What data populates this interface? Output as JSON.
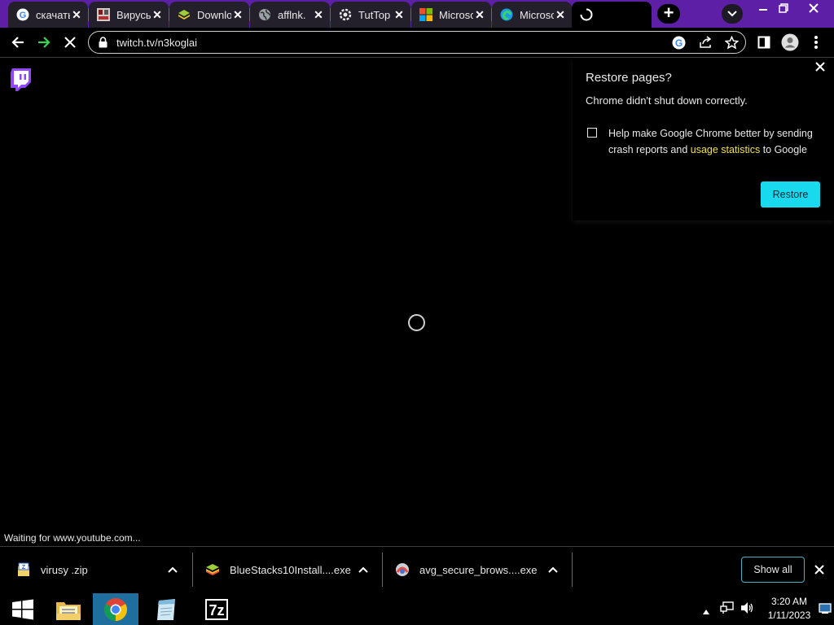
{
  "tabs": [
    {
      "title": "скачать",
      "icon": "google-icon"
    },
    {
      "title": "Вирусы",
      "icon": "site-thumbnail-icon"
    },
    {
      "title": "Download",
      "icon": "stack-icon"
    },
    {
      "title": "afflnk.",
      "icon": "globe-icon"
    },
    {
      "title": "TutTop",
      "icon": "gear-icon"
    },
    {
      "title": "Microsoft",
      "icon": "microsoft-icon"
    },
    {
      "title": "Microsoft",
      "icon": "edge-icon"
    },
    {
      "title": "",
      "icon": "loading-spinner-icon"
    }
  ],
  "toolbar": {
    "url": "twitch.tv/n3koglai"
  },
  "content": {
    "status": "Waiting for www.youtube.com..."
  },
  "restore_popup": {
    "title": "Restore pages?",
    "message": "Chrome didn't shut down correctly.",
    "checkbox_text_before": "Help make Google Chrome better by sending crash reports and ",
    "checkbox_link": "usage statistics",
    "checkbox_text_after": " to Google",
    "checked": false,
    "button": "Restore",
    "accent_color": "#19d9ef"
  },
  "downloads": {
    "items": [
      {
        "name": "virusy .zip",
        "icon": "zip-file-icon"
      },
      {
        "name": "BlueStacks10Install....exe",
        "icon": "bluestacks-icon"
      },
      {
        "name": "avg_secure_brows....exe",
        "icon": "avg-icon"
      }
    ],
    "show_all": "Show all"
  },
  "taskbar": {
    "time": "3:20 AM",
    "date": "1/11/2023",
    "apps": [
      "start-icon",
      "file-explorer-icon",
      "chrome-icon",
      "notepad-icon",
      "7zip-icon"
    ]
  },
  "colors": {
    "tabstrip": "#5c1fa6",
    "twitch": "#9146ff"
  }
}
